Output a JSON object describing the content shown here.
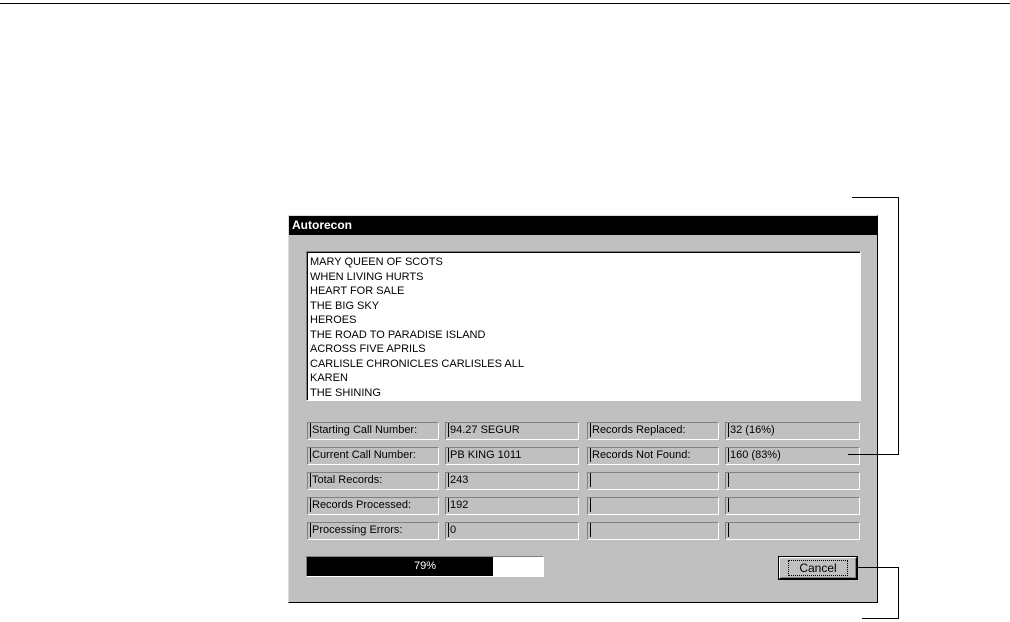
{
  "dialog": {
    "title": "Autorecon"
  },
  "titles_list": [
    "MARY QUEEN OF SCOTS",
    "WHEN LIVING HURTS",
    "HEART FOR SALE",
    "THE BIG SKY",
    "HEROES",
    "THE ROAD TO PARADISE ISLAND",
    "ACROSS FIVE APRILS",
    "CARLISLE CHRONICLES CARLISLES ALL",
    "KAREN",
    "THE SHINING"
  ],
  "stats": {
    "starting_call_number_label": "Starting Call Number:",
    "starting_call_number_value": "94.27 SEGUR",
    "current_call_number_label": "Current Call Number:",
    "current_call_number_value": "PB KING 1011",
    "total_records_label": "Total Records:",
    "total_records_value": "243",
    "records_processed_label": "Records Processed:",
    "records_processed_value": "192",
    "processing_errors_label": "Processing Errors:",
    "processing_errors_value": "0",
    "records_replaced_label": "Records Replaced:",
    "records_replaced_value": "32 (16%)",
    "records_not_found_label": "Records Not Found:",
    "records_not_found_value": "160 (83%)"
  },
  "progress": {
    "percent": 79,
    "label": "79%"
  },
  "buttons": {
    "cancel_label": "Cancel"
  },
  "colors": {
    "dialog_face": "#c0c0c0",
    "title_bar": "#000000",
    "progress_fill": "#000000"
  }
}
